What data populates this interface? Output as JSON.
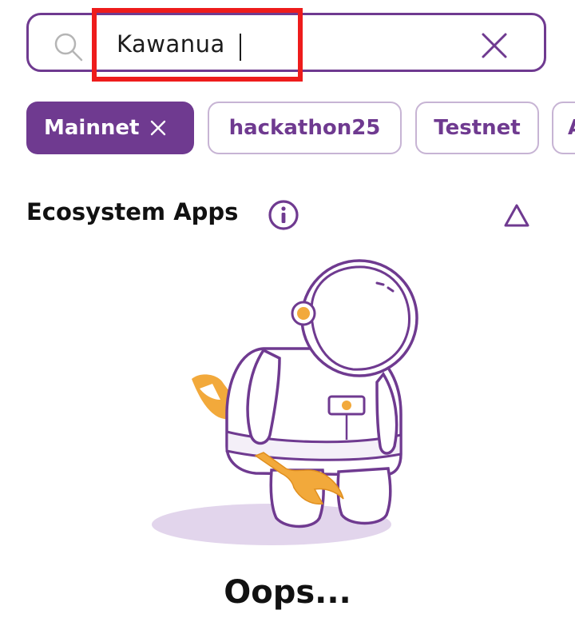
{
  "search": {
    "value": "Kawanua",
    "icon": "search-icon",
    "clear_icon": "close-icon"
  },
  "filters": [
    {
      "label": "Mainnet",
      "active": true
    },
    {
      "label": "hackathon25",
      "active": false
    },
    {
      "label": "Testnet",
      "active": false
    },
    {
      "label": "A",
      "active": false
    }
  ],
  "section": {
    "title": "Ecosystem Apps",
    "info_icon": "info-icon",
    "toggle_icon": "triangle-up-icon"
  },
  "empty_state": {
    "illustration": "astronaut-with-wrench",
    "title": "Oops..."
  },
  "colors": {
    "brand_purple": "#6f3a90",
    "chip_border": "#c7b4d4",
    "highlight_red": "#ee1c1c",
    "wrench_orange": "#f2a93b"
  }
}
